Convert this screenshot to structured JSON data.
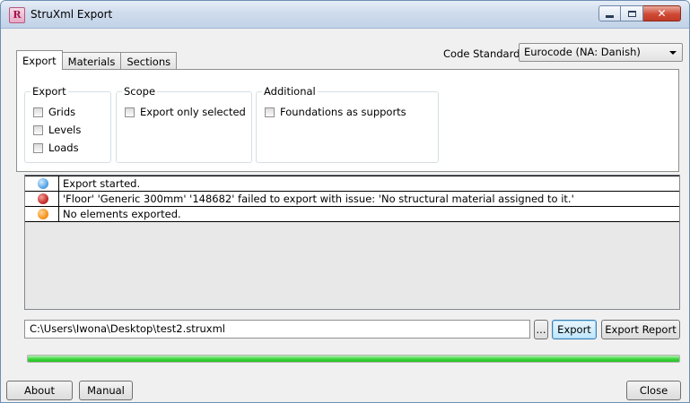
{
  "window": {
    "title": "StruXml Export",
    "app_icon_letter": "R"
  },
  "tabs": [
    {
      "label": "Export",
      "active": true
    },
    {
      "label": "Materials",
      "active": false
    },
    {
      "label": "Sections",
      "active": false
    }
  ],
  "code_standard": {
    "label": "Code Standard",
    "value": "Eurocode (NA: Danish)"
  },
  "groups": {
    "export": {
      "title": "Export",
      "options": [
        {
          "label": "Grids",
          "checked": false
        },
        {
          "label": "Levels",
          "checked": false
        },
        {
          "label": "Loads",
          "checked": false
        }
      ]
    },
    "scope": {
      "title": "Scope",
      "options": [
        {
          "label": "Export only selected",
          "checked": false
        }
      ]
    },
    "additional": {
      "title": "Additional",
      "options": [
        {
          "label": "Foundations as supports",
          "checked": false
        }
      ]
    }
  },
  "log": [
    {
      "status": "info",
      "color": "#5aa6e8",
      "message": "Export started."
    },
    {
      "status": "error",
      "color": "#c9302c",
      "message": "'Floor' 'Generic 300mm' '148682' failed to export with issue: 'No structural material assigned to it.'"
    },
    {
      "status": "warning",
      "color": "#f7941d",
      "message": "No elements exported."
    }
  ],
  "file_path": "C:\\Users\\Iwona\\Desktop\\test2.struxml",
  "buttons": {
    "browse": "...",
    "export": "Export",
    "export_report": "Export Report",
    "about": "About",
    "manual": "Manual",
    "close": "Close"
  },
  "progress": {
    "value": 1.0
  }
}
